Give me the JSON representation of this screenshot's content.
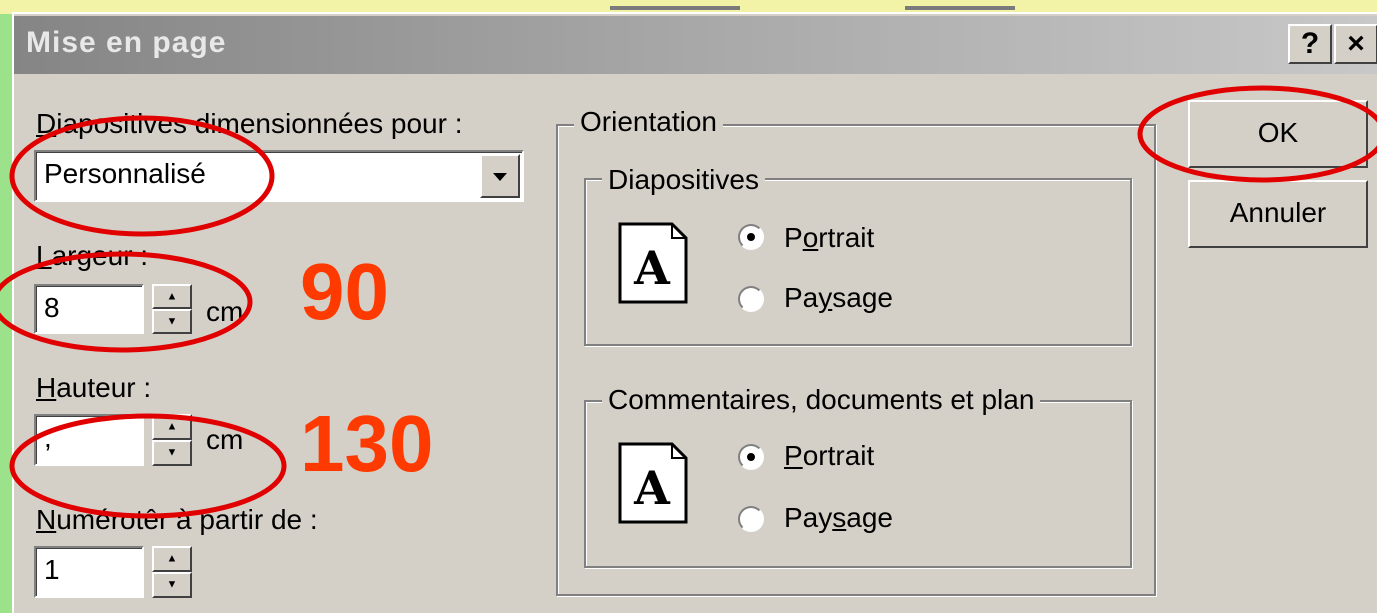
{
  "dialog": {
    "title": "Mise en page",
    "help_label": "?",
    "close_label": "×"
  },
  "slide_size": {
    "label_pre": "D",
    "label_rest": "iapositives dimensionnées pour :",
    "value": "Personnalisé"
  },
  "width": {
    "label_u": "L",
    "label_rest": "argeur :",
    "value": "8",
    "unit": "cm"
  },
  "height": {
    "label_u": "H",
    "label_rest": "auteur :",
    "value": ",",
    "unit": "cm"
  },
  "numbering": {
    "label_u": "N",
    "label_rest": "umérotêr à partir de :",
    "value": "1"
  },
  "orientation": {
    "title": "Orientation",
    "slides": {
      "title": "Diapositives",
      "portrait_pre": "P",
      "portrait_u": "o",
      "portrait_post": "rtrait",
      "landscape_pre": "Pa",
      "landscape_u": "y",
      "landscape_post": "sage",
      "selected": "portrait"
    },
    "notes": {
      "title": "Commentaires, documents et plan",
      "portrait_pre": "",
      "portrait_u": "P",
      "portrait_post": "ortrait",
      "landscape_pre": "Pay",
      "landscape_u": "s",
      "landscape_post": "age",
      "selected": "portrait"
    },
    "page_icon_letter": "A"
  },
  "buttons": {
    "ok": "OK",
    "cancel": "Annuler"
  },
  "annotations": {
    "width_value": "90",
    "height_value": "130",
    "color": "#ff3a00",
    "circle_color": "#e00000"
  }
}
